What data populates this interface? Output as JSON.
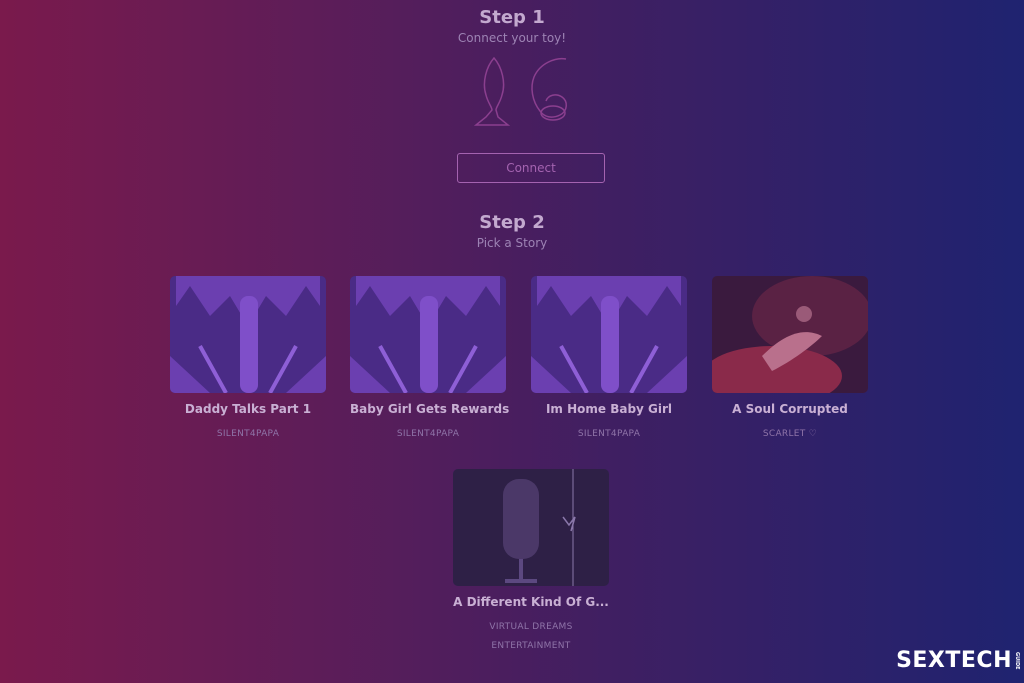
{
  "step1": {
    "title": "Step 1",
    "subtitle": "Connect your toy!",
    "connect_label": "Connect"
  },
  "step2": {
    "title": "Step 2",
    "subtitle": "Pick a Story"
  },
  "stories": [
    {
      "title": "Daddy Talks Part 1",
      "author": "SILENT4PAPA"
    },
    {
      "title": "Baby Girl Gets Rewards",
      "author": "SILENT4PAPA"
    },
    {
      "title": "Im Home Baby Girl",
      "author": "SILENT4PAPA"
    },
    {
      "title": "A Soul Corrupted",
      "author": "SCARLET ♡"
    },
    {
      "title": "A Different Kind Of G...",
      "author": "VIRTUAL DREAMS ENTERTAINMENT"
    }
  ],
  "branding": {
    "logo": "SEXTECH",
    "logo_suffix": "GUIDE"
  },
  "colors": {
    "accent": "#a463b0",
    "gradient_left": "#7a1a4c",
    "gradient_right": "#1f2370"
  }
}
